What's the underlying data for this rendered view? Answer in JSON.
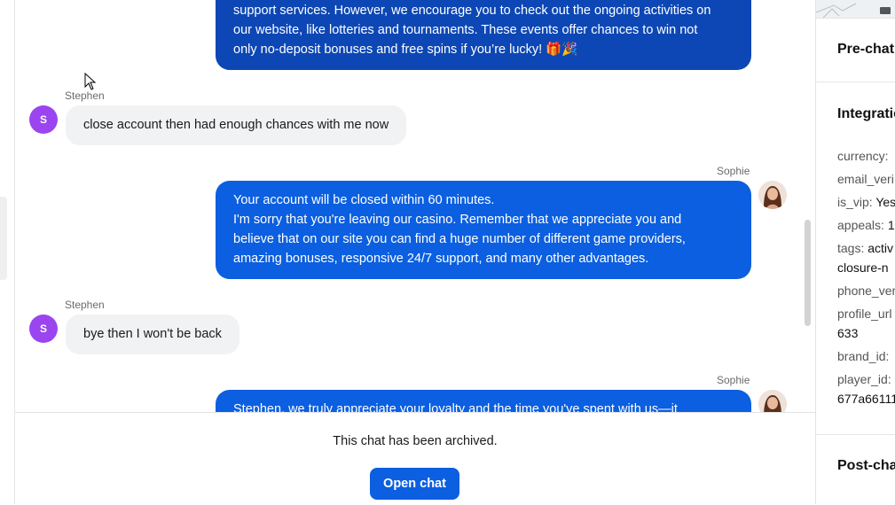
{
  "messages": [
    {
      "role": "agent",
      "text_lines": [
        "support services. However, we encourage you to check out the ongoing activities on",
        "our website, like lotteries and tournaments. These events offer chances to win not",
        "only no-deposit bonuses and free spins if you’re lucky! 🎁🎉"
      ]
    },
    {
      "role": "user",
      "sender": "Stephen",
      "avatar_letter": "S",
      "text": "close account then had enough chances with me now"
    },
    {
      "role": "agent",
      "sender": "Sophie",
      "text_lines": [
        "Your account will be closed within 60 minutes.",
        "I'm sorry that you're leaving our casino. Remember that we appreciate you and",
        "believe that on our site you can find a huge number of different game providers,",
        "amazing bonuses, responsive 24/7 support, and many other advantages."
      ]
    },
    {
      "role": "user",
      "sender": "Stephen",
      "avatar_letter": "S",
      "text": "bye then I won't be back"
    },
    {
      "role": "agent",
      "sender": "Sophie",
      "text_lines": [
        "Stephen, we truly appreciate your loyalty and the time you've spent with us—it"
      ]
    }
  ],
  "archive": {
    "notice": "This chat has been archived.",
    "open_button": "Open chat"
  },
  "sidebar": {
    "prechat_title": "Pre-chat",
    "integrations_title": "Integratio",
    "fields": [
      {
        "key": "currency:",
        "value": ""
      },
      {
        "key": "email_veri",
        "value": ""
      },
      {
        "key": "is_vip:",
        "value": "Yes"
      },
      {
        "key": "appeals:",
        "value": "1"
      },
      {
        "key": "tags:",
        "value": "activ"
      },
      {
        "key": "",
        "value": "closure-n"
      },
      {
        "key": "phone_ver",
        "value": ""
      },
      {
        "key": "profile_url",
        "value": ""
      },
      {
        "key": "",
        "value": "633"
      },
      {
        "key": "brand_id:",
        "value": ""
      },
      {
        "key": "player_id:",
        "value": ""
      },
      {
        "key": "",
        "value": "677a66111"
      }
    ],
    "postchat_title": "Post-cha"
  },
  "colors": {
    "agent_bubble": "#0b5fe0",
    "user_bubble": "#f1f2f4",
    "user_avatar": "#9b45f0",
    "link": "#0b5fe0"
  }
}
